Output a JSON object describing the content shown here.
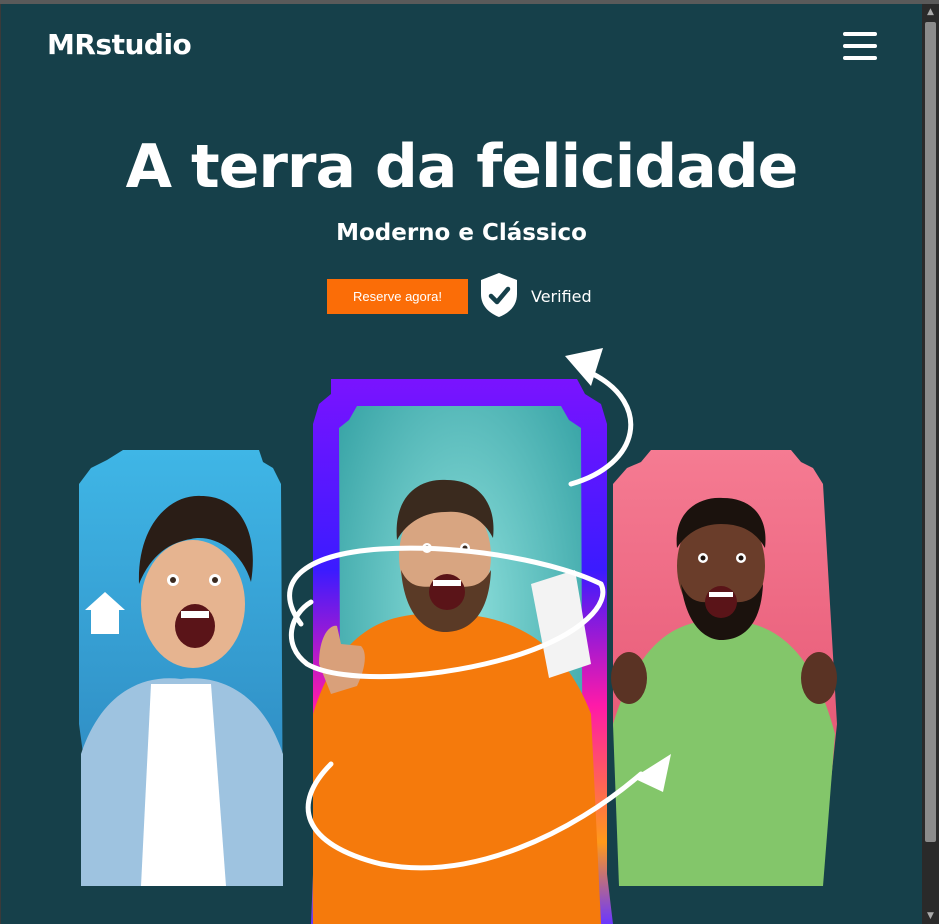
{
  "brand": {
    "name": "MRstudio"
  },
  "nav": {
    "menu_icon": "hamburger-menu-icon"
  },
  "hero": {
    "title": "A terra da felicidade",
    "subtitle": "Moderno e Clássico",
    "cta_label": "Reserve agora!",
    "badge_icon": "shield-check-icon",
    "badge_label": "Verified"
  },
  "colors": {
    "background": "#16404a",
    "cta": "#fb6d07",
    "text": "#ffffff",
    "left_card": "#3aa8d8",
    "center_card": "#7ed6d6",
    "center_frame": "#8a1cff",
    "right_card": "#f26d86"
  }
}
